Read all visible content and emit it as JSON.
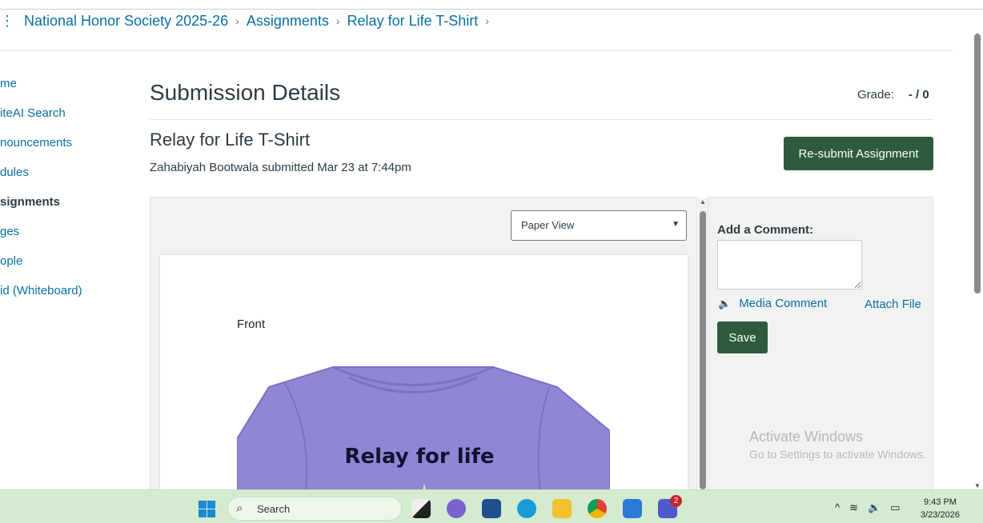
{
  "breadcrumbs": [
    "National Honor Society 2025-26",
    "Assignments",
    "Relay for Life T-Shirt"
  ],
  "nav": [
    {
      "label": "me",
      "active": false
    },
    {
      "label": "iteAI Search",
      "active": false
    },
    {
      "label": "nouncements",
      "active": false
    },
    {
      "label": "dules",
      "active": false
    },
    {
      "label": "signments",
      "active": true
    },
    {
      "label": "ges",
      "active": false
    },
    {
      "label": "ople",
      "active": false
    },
    {
      "label": "id (Whiteboard)",
      "active": false
    }
  ],
  "page": {
    "title": "Submission Details",
    "grade_label": "Grade:",
    "grade_value": "- / 0",
    "assignment_title": "Relay for Life T-Shirt",
    "submitted_by": "Zahabiyah Bootwala submitted Mar 23 at 7:44pm",
    "resubmit_label": "Re-submit Assignment"
  },
  "viewer": {
    "view_select": "Paper View",
    "front_label": "Front",
    "shirt_text": "Relay for life"
  },
  "comment": {
    "label": "Add a Comment:",
    "value": "",
    "media_label": "Media Comment",
    "attach_label": "Attach File",
    "save_label": "Save"
  },
  "watermark": {
    "title": "Activate Windows",
    "subtitle": "Go to Settings to activate Windows."
  },
  "taskbar": {
    "search_placeholder": "Search",
    "time": "9:43 PM",
    "date": "3/23/2026",
    "teams_badge": "2"
  },
  "colors": {
    "link": "#0770a3",
    "button": "#2e5b3e",
    "shirt": "#8f86d6"
  }
}
